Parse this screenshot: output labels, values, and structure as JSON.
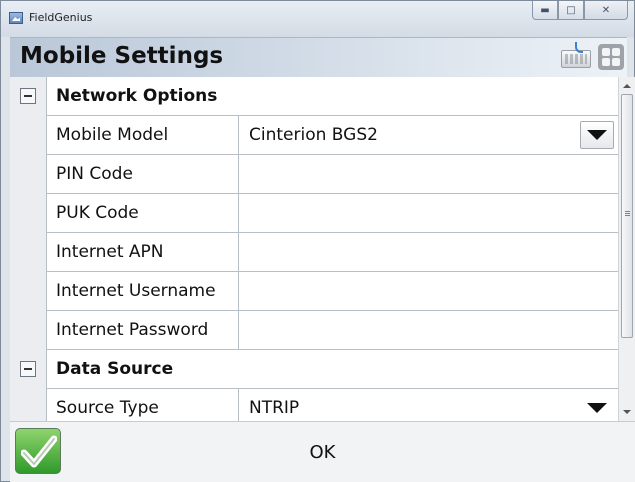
{
  "window": {
    "app_title": "FieldGenius"
  },
  "header": {
    "title": "Mobile Settings"
  },
  "sections": [
    {
      "title": "Network Options",
      "rows": [
        {
          "label": "Mobile Model",
          "value": "Cinterion BGS2",
          "dropdown": true
        },
        {
          "label": "PIN Code",
          "value": ""
        },
        {
          "label": "PUK Code",
          "value": ""
        },
        {
          "label": "Internet APN",
          "value": ""
        },
        {
          "label": "Internet Username",
          "value": ""
        },
        {
          "label": "Internet Password",
          "value": ""
        }
      ]
    },
    {
      "title": "Data Source",
      "rows": [
        {
          "label": "Source Type",
          "value": "NTRIP",
          "dropdown": true
        }
      ]
    }
  ],
  "footer": {
    "ok_label": "OK"
  },
  "icons": {
    "app": "fieldgenius-app-icon",
    "keyboard": "keyboard-icon",
    "menu": "grid-menu-icon",
    "ok": "green-check-icon"
  }
}
